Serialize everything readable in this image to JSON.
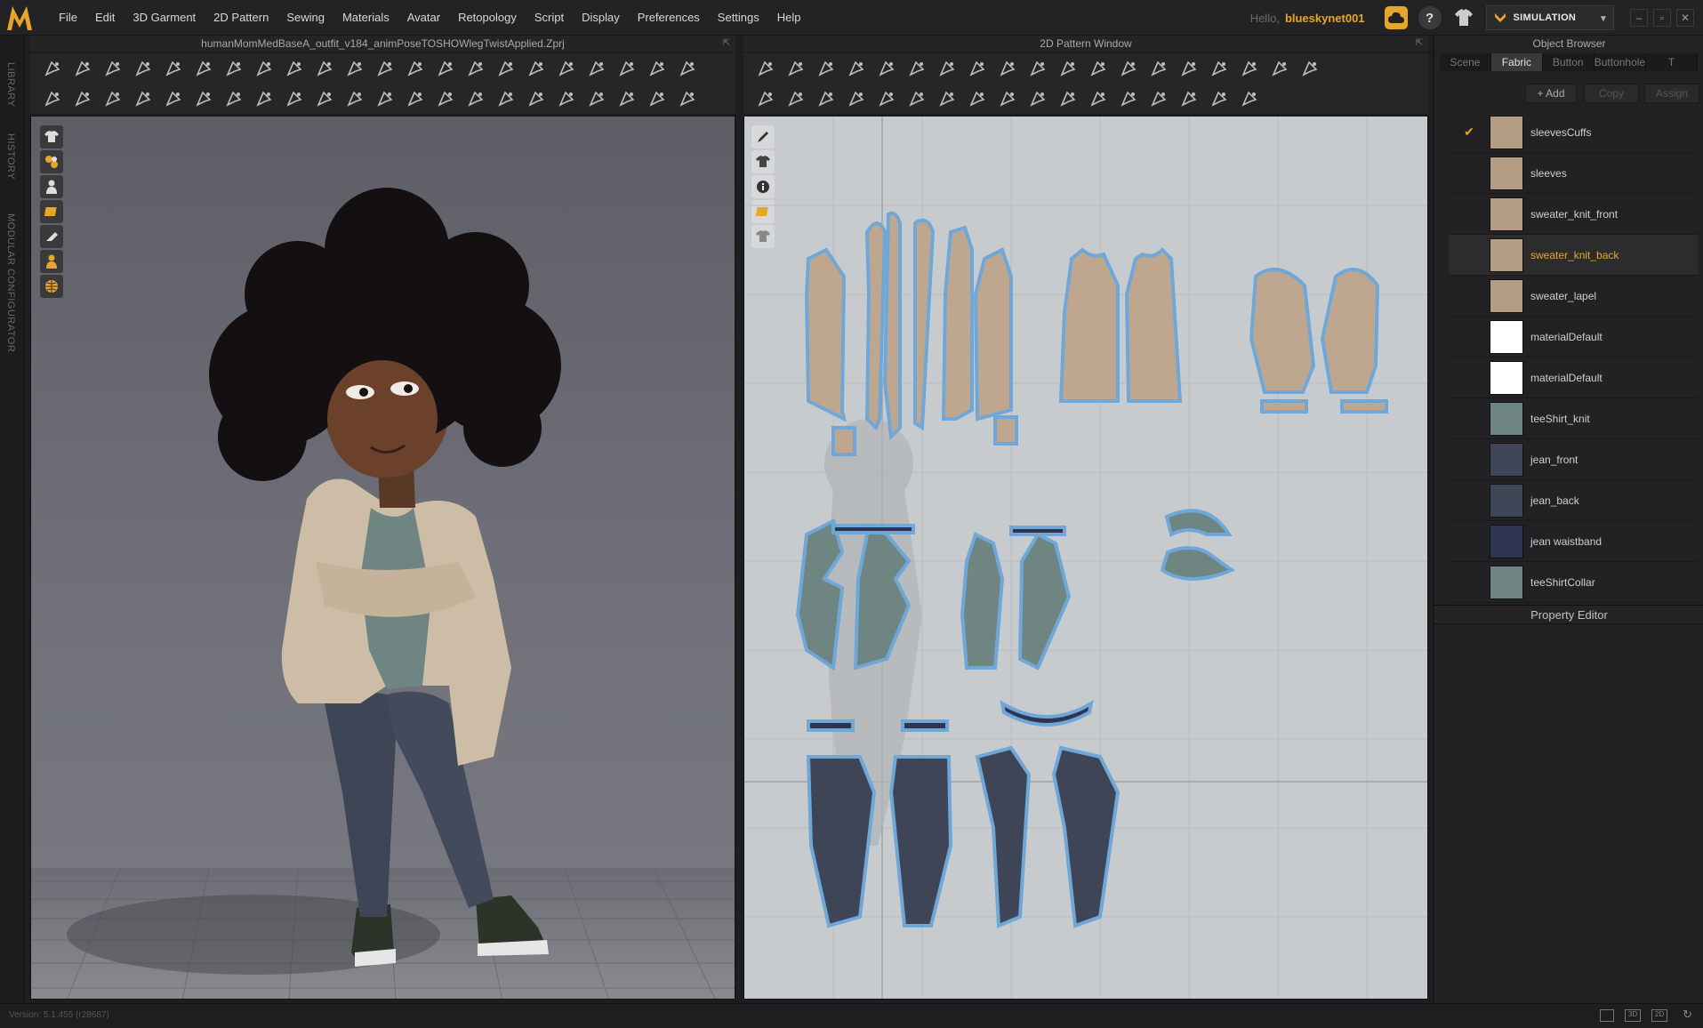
{
  "app": {
    "logo": "marvelous-designer-logo",
    "menus": [
      "File",
      "Edit",
      "3D Garment",
      "2D Pattern",
      "Sewing",
      "Materials",
      "Avatar",
      "Retopology",
      "Script",
      "Display",
      "Preferences",
      "Settings",
      "Help"
    ],
    "hello": "Hello,",
    "username": "blueskynet001",
    "mode_button": "SIMULATION"
  },
  "left_strip": [
    "LIBRARY",
    "HISTORY",
    "MODULAR CONFIGURATOR"
  ],
  "viewport3d": {
    "title": "humanMomMedBaseA_outfit_v184_animPoseTOSHOWlegTwistApplied.Zprj"
  },
  "viewport2d": {
    "title": "2D Pattern Window"
  },
  "object_browser": {
    "title": "Object Browser",
    "tabs": [
      "Scene",
      "Fabric",
      "Button",
      "Buttonhole",
      "T"
    ],
    "active_tab": "Fabric",
    "add_label": "+ Add",
    "copy_label": "Copy",
    "assign_label": "Assign",
    "fabrics": [
      {
        "name": "sleevesCuffs",
        "color": "#b59d85",
        "checked": true
      },
      {
        "name": "sleeves",
        "color": "#b59d85"
      },
      {
        "name": "sweater_knit_front",
        "color": "#b59d85"
      },
      {
        "name": "sweater_knit_back",
        "color": "#b59d85",
        "selected": true
      },
      {
        "name": "sweater_lapel",
        "color": "#b59d85"
      },
      {
        "name": "materialDefault",
        "color": "#ffffff"
      },
      {
        "name": "materialDefault",
        "color": "#ffffff"
      },
      {
        "name": "teeShirt_knit",
        "color": "#6f8581"
      },
      {
        "name": "jean_front",
        "color": "#3d4556"
      },
      {
        "name": "jean_back",
        "color": "#3d4556"
      },
      {
        "name": "jean waistband",
        "color": "#2f3550"
      },
      {
        "name": "teeShirtCollar",
        "color": "#6f8581"
      }
    ],
    "property_editor": "Property Editor"
  },
  "status": {
    "version": "Version: 5.1.455 (r28687)"
  }
}
